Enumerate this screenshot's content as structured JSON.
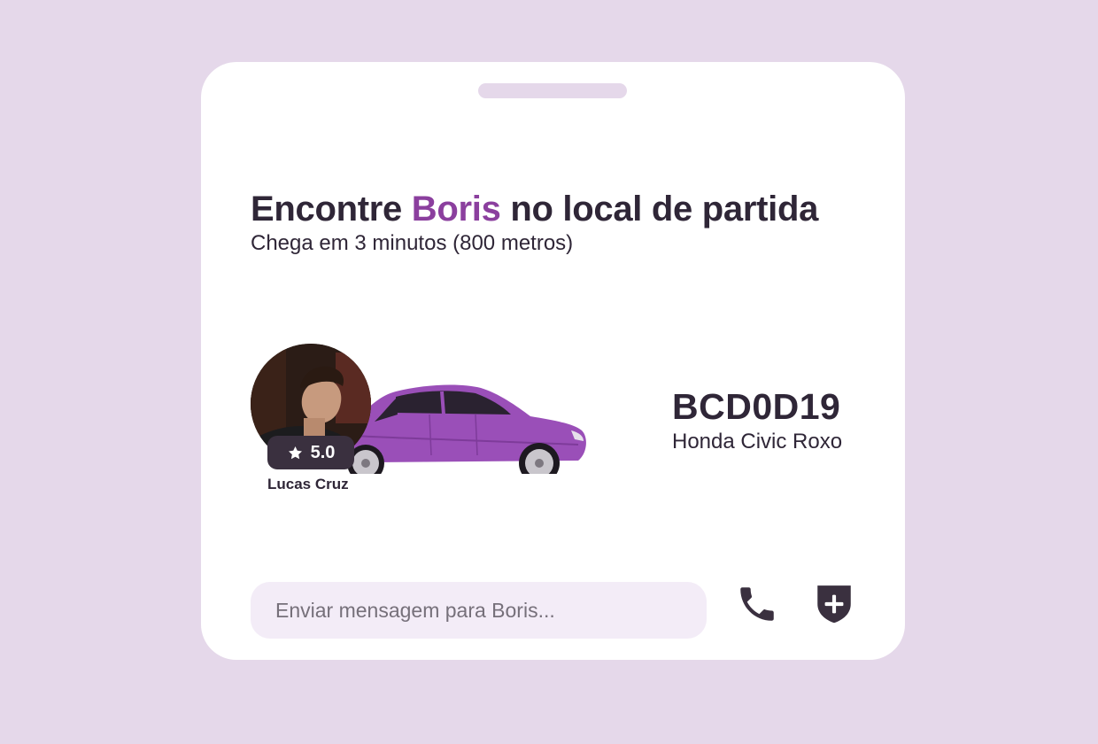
{
  "header": {
    "title_prefix": "Encontre ",
    "driver_first_name": "Boris",
    "title_suffix": " no local de partida",
    "subtitle": "Chega em 3 minutos (800 metros)"
  },
  "driver": {
    "rating": "5.0",
    "name": "Lucas Cruz"
  },
  "vehicle": {
    "plate": "BCD0D19",
    "model": "Honda Civic Roxo"
  },
  "message": {
    "placeholder": "Enviar mensagem para Boris..."
  },
  "icons": {
    "call": "phone-icon",
    "safety": "shield-plus-icon",
    "rating": "star-icon"
  },
  "colors": {
    "background": "#e5d8ea",
    "accent": "#8b3f9e",
    "text": "#2f2637",
    "car": "#9a4fb8",
    "input_bg": "#f3ecf7"
  }
}
